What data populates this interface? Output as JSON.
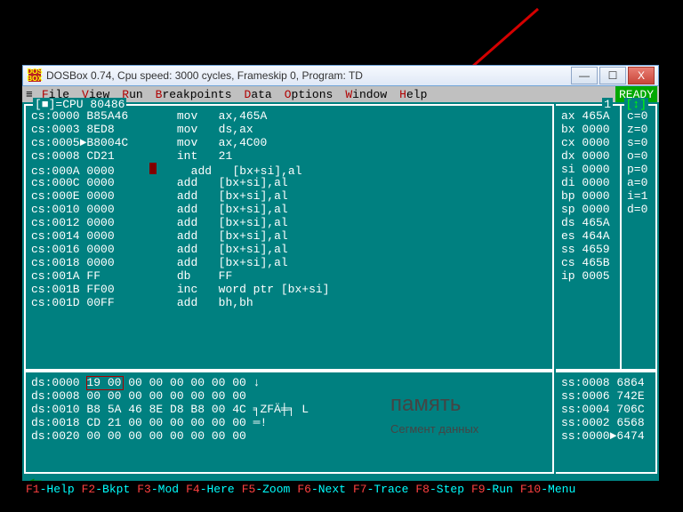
{
  "window": {
    "title": "DOSBox 0.74, Cpu speed:    3000 cycles, Frameskip  0, Program:    TD",
    "icon_text": "DOS\nBOX",
    "min": "—",
    "max": "☐",
    "close": "X"
  },
  "menubar": {
    "burger": "≡",
    "items": [
      {
        "hot": "F",
        "rest": "ile"
      },
      {
        "hot": "V",
        "rest": "iew"
      },
      {
        "hot": "R",
        "rest": "un"
      },
      {
        "hot": "B",
        "rest": "reakpoints"
      },
      {
        "hot": "D",
        "rest": "ata"
      },
      {
        "hot": "O",
        "rest": "ptions"
      },
      {
        "hot": "W",
        "rest": "indow"
      },
      {
        "hot": "H",
        "rest": "elp"
      }
    ],
    "ready": "READY"
  },
  "cpu": {
    "title_left": "[■]=CPU 80486",
    "title_right": "1",
    "flag_title": "[↕]",
    "lines": [
      {
        "a": "cs:0000",
        "b": "B85A46",
        "m": "mov",
        "o": "ax,465A"
      },
      {
        "a": "cs:0003",
        "b": "8ED8",
        "m": "mov",
        "o": "ds,ax"
      },
      {
        "a": "cs:0005",
        "b": "B8004C",
        "m": "mov",
        "o": "ax,4C00",
        "bp": true
      },
      {
        "a": "cs:0008",
        "b": "CD21",
        "m": "int",
        "o": "21"
      },
      {
        "a": "cs:000A",
        "b": "0000",
        "m": "add",
        "o": "[bx+si],al",
        "cur": true
      },
      {
        "a": "cs:000C",
        "b": "0000",
        "m": "add",
        "o": "[bx+si],al"
      },
      {
        "a": "cs:000E",
        "b": "0000",
        "m": "add",
        "o": "[bx+si],al"
      },
      {
        "a": "cs:0010",
        "b": "0000",
        "m": "add",
        "o": "[bx+si],al"
      },
      {
        "a": "cs:0012",
        "b": "0000",
        "m": "add",
        "o": "[bx+si],al"
      },
      {
        "a": "cs:0014",
        "b": "0000",
        "m": "add",
        "o": "[bx+si],al"
      },
      {
        "a": "cs:0016",
        "b": "0000",
        "m": "add",
        "o": "[bx+si],al"
      },
      {
        "a": "cs:0018",
        "b": "0000",
        "m": "add",
        "o": "[bx+si],al"
      },
      {
        "a": "cs:001A",
        "b": "FF",
        "m": "db",
        "o": "FF"
      },
      {
        "a": "cs:001B",
        "b": "FF00",
        "m": "inc",
        "o": "word ptr [bx+si]"
      },
      {
        "a": "cs:001D",
        "b": "00FF",
        "m": "add",
        "o": "bh,bh"
      }
    ]
  },
  "regs": [
    {
      "n": "ax",
      "v": "465A"
    },
    {
      "n": "bx",
      "v": "0000"
    },
    {
      "n": "cx",
      "v": "0000"
    },
    {
      "n": "dx",
      "v": "0000"
    },
    {
      "n": "si",
      "v": "0000"
    },
    {
      "n": "di",
      "v": "0000"
    },
    {
      "n": "bp",
      "v": "0000"
    },
    {
      "n": "sp",
      "v": "0000"
    },
    {
      "n": "ds",
      "v": "465A"
    },
    {
      "n": "es",
      "v": "464A"
    },
    {
      "n": "ss",
      "v": "4659"
    },
    {
      "n": "cs",
      "v": "465B"
    },
    {
      "n": "ip",
      "v": "0005"
    }
  ],
  "flags": [
    {
      "n": "c",
      "v": "0"
    },
    {
      "n": "z",
      "v": "0"
    },
    {
      "n": "s",
      "v": "0"
    },
    {
      "n": "o",
      "v": "0"
    },
    {
      "n": "p",
      "v": "0"
    },
    {
      "n": "a",
      "v": "0"
    },
    {
      "n": "i",
      "v": "1"
    },
    {
      "n": "d",
      "v": "0"
    }
  ],
  "dump": [
    {
      "a": "ds:0000",
      "h": "19 00 00 00 00 00 00 00",
      "t": "↓"
    },
    {
      "a": "ds:0008",
      "h": "00 00 00 00 00 00 00 00",
      "t": ""
    },
    {
      "a": "ds:0010",
      "h": "B8 5A 46 8E D8 B8 00 4C",
      "t": "╕ZFÄ╪╕ L"
    },
    {
      "a": "ds:0018",
      "h": "CD 21 00 00 00 00 00 00",
      "t": "═!"
    },
    {
      "a": "ds:0020",
      "h": "00 00 00 00 00 00 00 00",
      "t": ""
    }
  ],
  "stack": [
    {
      "a": "ss:0008",
      "v": "6864"
    },
    {
      "a": "ss:0006",
      "v": "742E"
    },
    {
      "a": "ss:0004",
      "v": "706C"
    },
    {
      "a": "ss:0002",
      "v": "6568"
    },
    {
      "a": "ss:0000",
      "v": "6474",
      "cur": true
    }
  ],
  "funcbar": [
    {
      "k": "F1",
      "t": "-Help"
    },
    {
      "k": "F2",
      "t": "-Bkpt"
    },
    {
      "k": "F3",
      "t": "-Mod"
    },
    {
      "k": "F4",
      "t": "-Here"
    },
    {
      "k": "F5",
      "t": "-Zoom"
    },
    {
      "k": "F6",
      "t": "-Next"
    },
    {
      "k": "F7",
      "t": "-Trace"
    },
    {
      "k": "F8",
      "t": "-Step"
    },
    {
      "k": "F9",
      "t": "-Run"
    },
    {
      "k": "F10",
      "t": "-Menu"
    }
  ],
  "annot": {
    "big": "память",
    "small": "Сегмент данных"
  },
  "scroll_left": "◄═"
}
